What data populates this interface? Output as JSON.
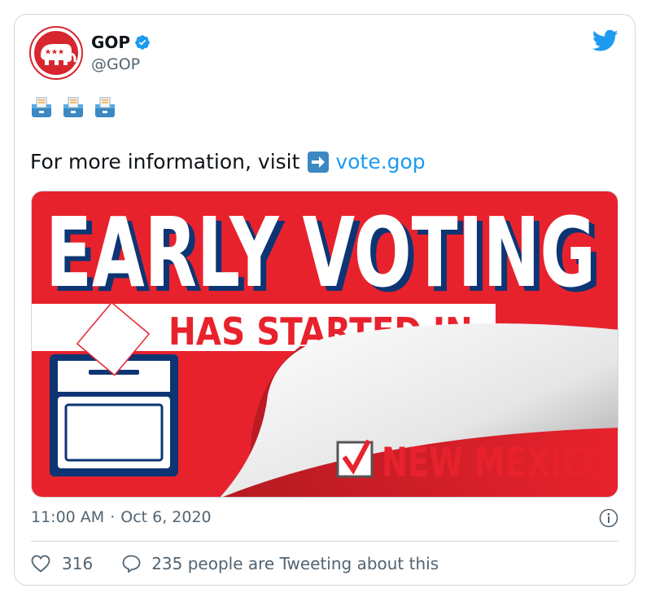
{
  "author": {
    "name": "GOP",
    "handle": "@GOP",
    "verified_icon": "verified-badge-icon",
    "avatar_icon": "republican-elephant-logo"
  },
  "tweet": {
    "emoji_row": [
      "ballot-box-icon",
      "ballot-box-icon",
      "ballot-box-icon"
    ],
    "text_prefix": "For more information, visit",
    "text_emoji": "right-arrow-emoji",
    "link_text": "vote.gop"
  },
  "media": {
    "headline": "EARLY VOTING",
    "subheadline": "HAS STARTED IN:",
    "state": "NEW MEXICO",
    "check_icon": "checkbox-checked-icon"
  },
  "meta": {
    "time": "11:00 AM",
    "separator": "·",
    "date": "Oct 6, 2020"
  },
  "actions": {
    "likes": "316",
    "replies_text": "235 people are Tweeting about this"
  },
  "colors": {
    "twitter_blue": "#1d9bf0",
    "gop_red": "#e8222d",
    "gop_navy": "#0d3573"
  }
}
